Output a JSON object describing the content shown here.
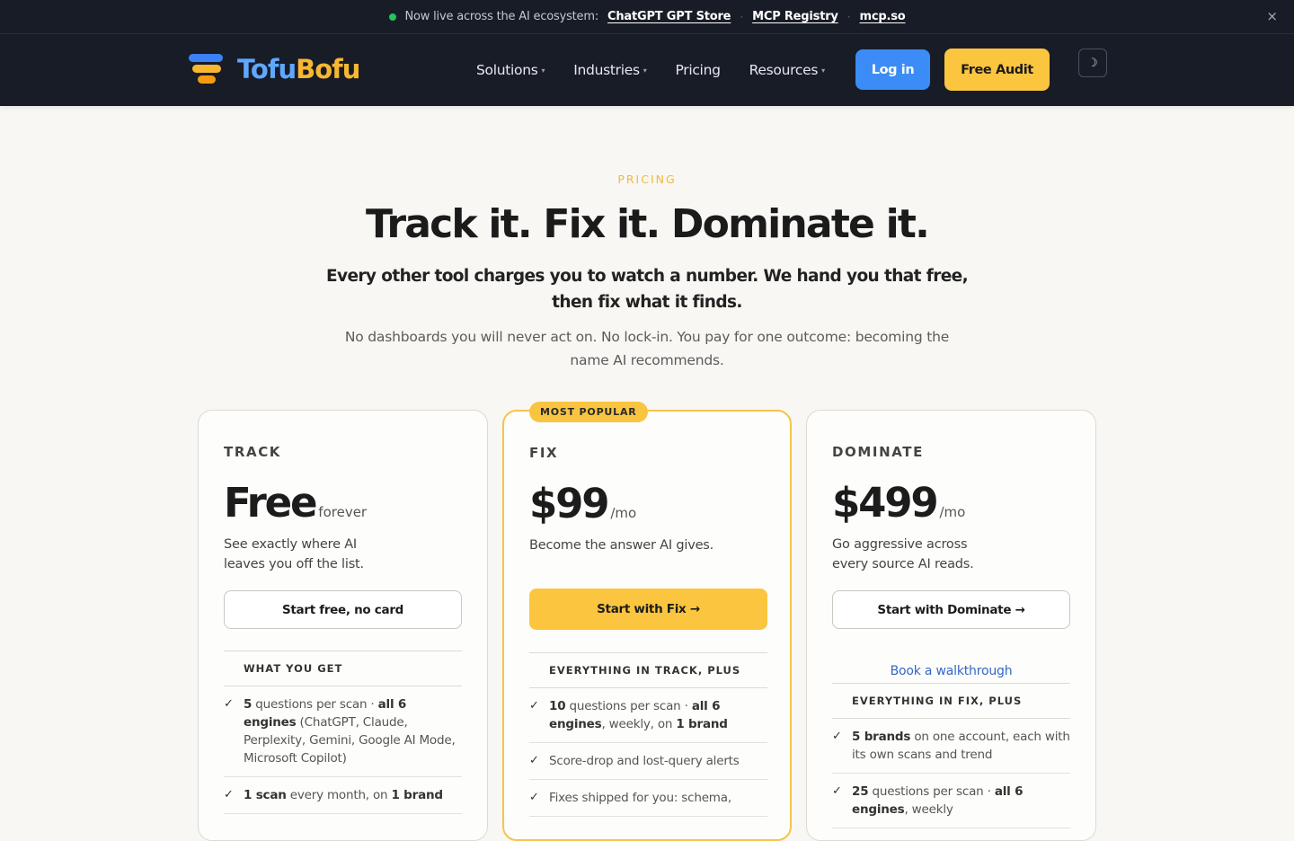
{
  "announcement": {
    "text": "Now live across the AI ecosystem:",
    "links": [
      "ChatGPT GPT Store",
      "MCP Registry",
      "mcp.so"
    ],
    "separator": "·",
    "close": "×"
  },
  "nav": {
    "brand_part1": "Tofu",
    "brand_part2": "Bofu",
    "menu": [
      {
        "label": "Solutions",
        "caret": "▾"
      },
      {
        "label": "Industries",
        "caret": "▾"
      },
      {
        "label": "Pricing",
        "caret": ""
      },
      {
        "label": "Resources",
        "caret": "▾"
      }
    ],
    "login": "Log in",
    "audit": "Free Audit",
    "theme_icon": "☽"
  },
  "hero": {
    "eyebrow": "PRICING",
    "headline": "Track it. Fix it. Dominate it.",
    "subhead": "Every other tool charges you to watch a number. We hand you that free, then fix what it finds.",
    "desc": "No dashboards you will never act on. No lock-in. You pay for one outcome: becoming the name AI recommends."
  },
  "plans": [
    {
      "tier": "TRACK",
      "price": "Free",
      "period": "forever",
      "tagline": "See exactly where AI leaves you off the list.",
      "cta": "Start free, no card",
      "features_head": "WHAT YOU GET",
      "features": [
        {
          "pre": "",
          "b1": "5",
          "mid": " questions per scan · ",
          "b2": "all 6 engines",
          "post": " (ChatGPT, Claude, Perplexity, Gemini, Google AI Mode, Microsoft Copilot)"
        },
        {
          "pre": "",
          "b1": "1 scan",
          "mid": " every month, on ",
          "b2": "1 brand",
          "post": ""
        }
      ]
    },
    {
      "badge": "MOST POPULAR",
      "tier": "FIX",
      "price": "$99",
      "period": "/mo",
      "tagline": "Become the answer AI gives.",
      "cta": "Start with Fix →",
      "features_head": "EVERYTHING IN TRACK, PLUS",
      "features": [
        {
          "pre": "",
          "b1": "10",
          "mid": " questions per scan · ",
          "b2": "all 6 engines",
          "post": ", weekly, on ",
          "b3": "1 brand"
        },
        {
          "pre": "Score-drop and lost-query alerts",
          "b1": "",
          "mid": "",
          "b2": "",
          "post": ""
        },
        {
          "pre": "Fixes shipped for you: schema,",
          "b1": "",
          "mid": "",
          "b2": "",
          "post": ""
        }
      ]
    },
    {
      "tier": "DOMINATE",
      "price": "$499",
      "period": "/mo",
      "tagline": "Go aggressive across every source AI reads.",
      "cta": "Start with Dominate →",
      "walkthrough": "Book a walkthrough",
      "features_head": "EVERYTHING IN FIX, PLUS",
      "features": [
        {
          "pre": "",
          "b1": "5 brands",
          "mid": " on one account, each with its own scans and trend",
          "b2": "",
          "post": ""
        },
        {
          "pre": "",
          "b1": "25",
          "mid": " questions per scan · ",
          "b2": "all 6 engines",
          "post": ", weekly"
        }
      ]
    }
  ],
  "check": "✓"
}
